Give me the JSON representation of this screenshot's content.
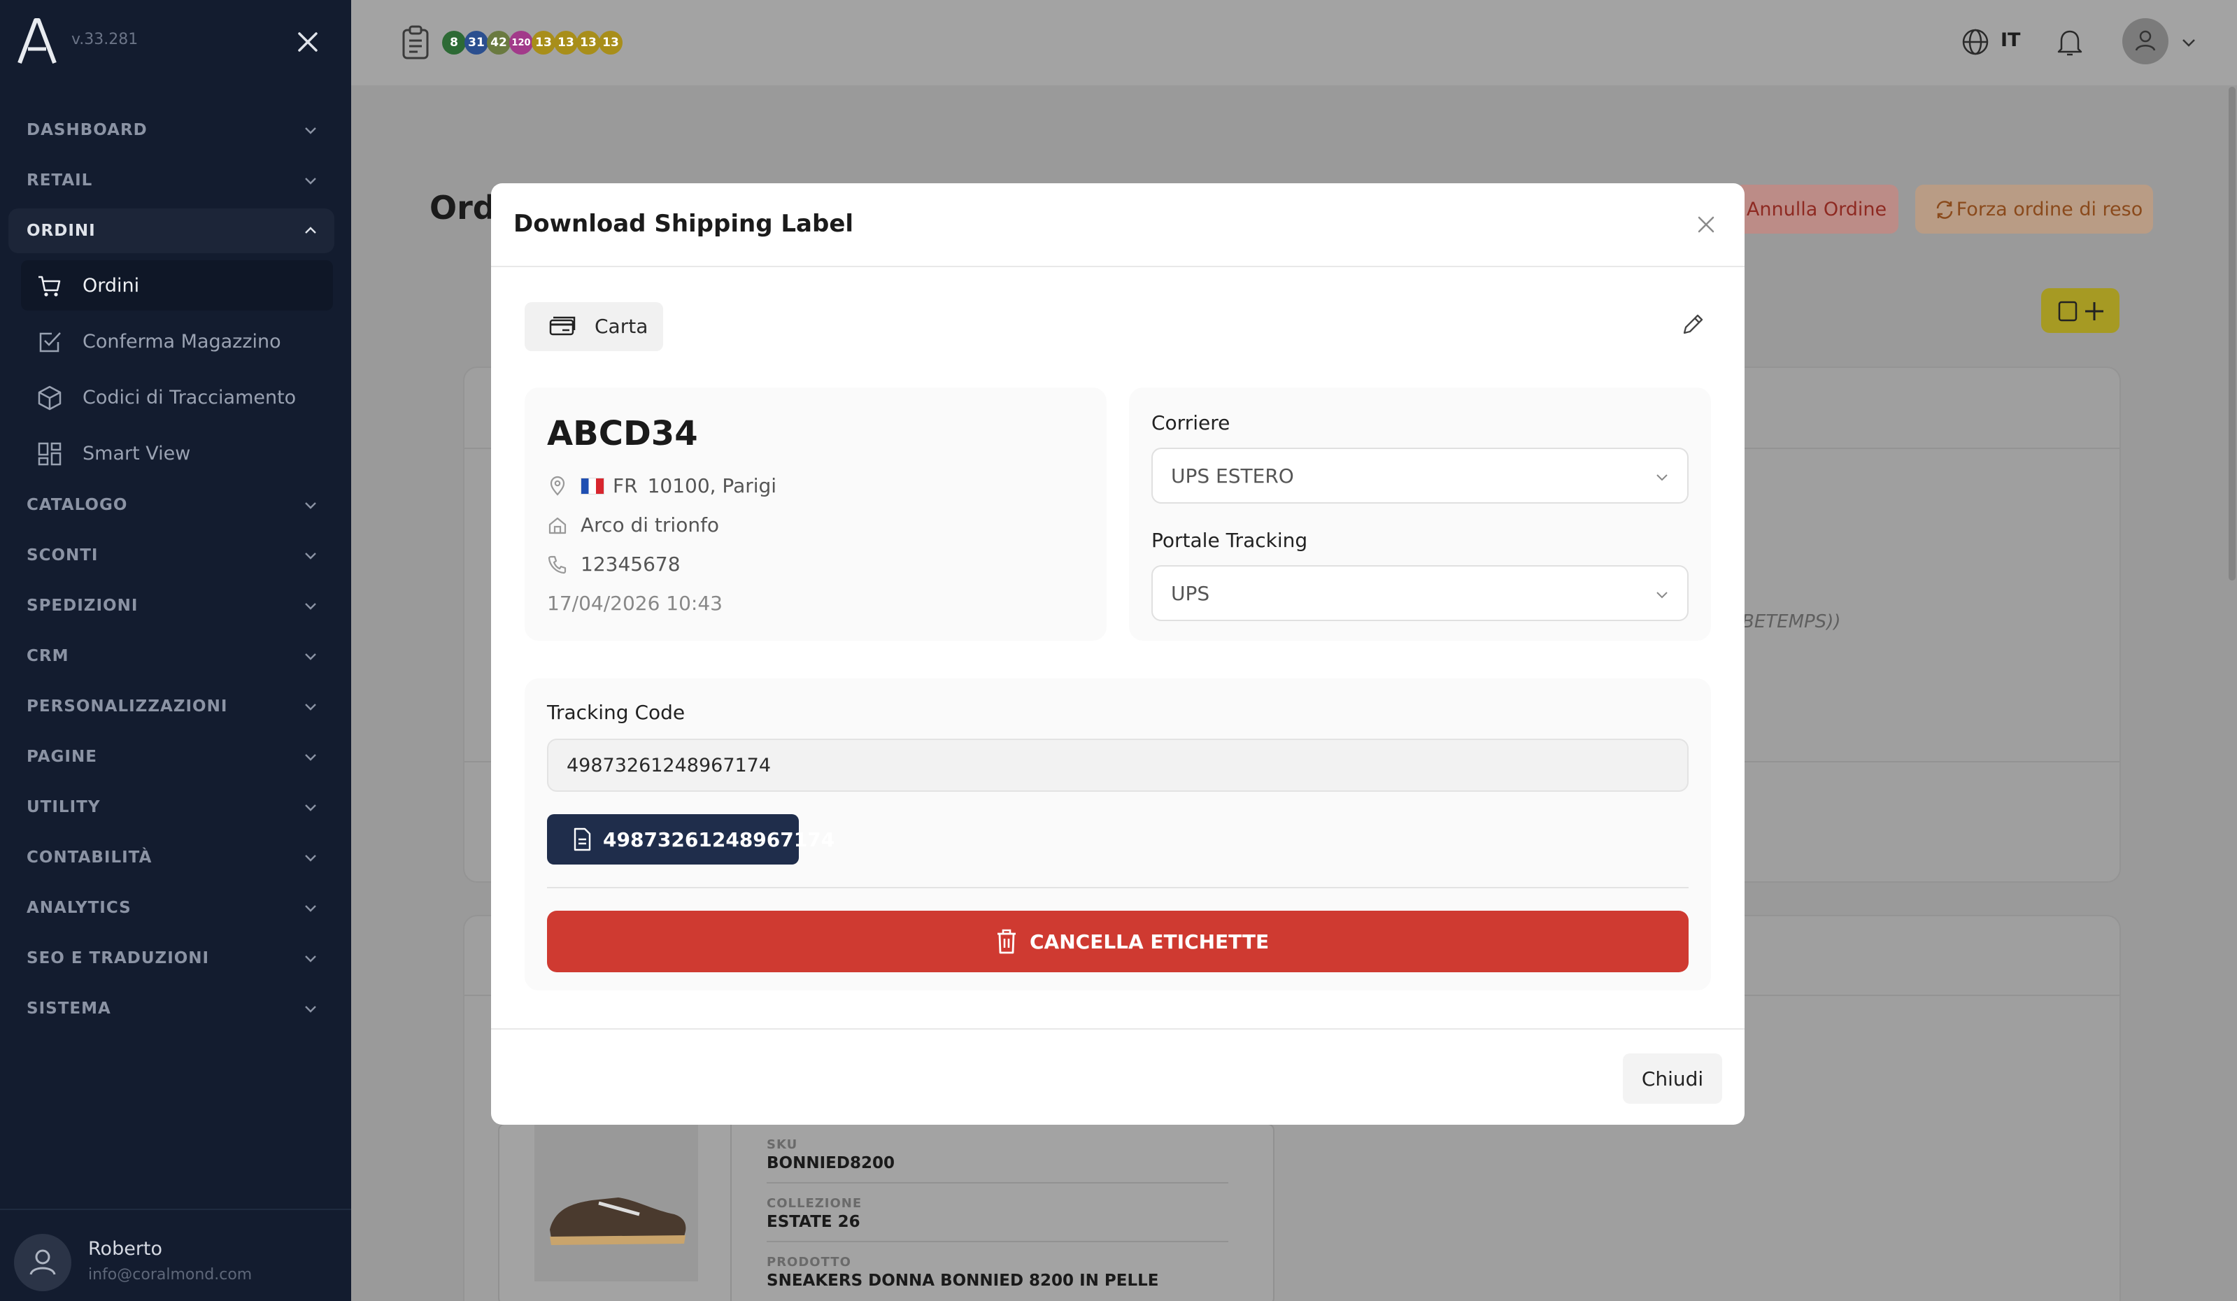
{
  "app": {
    "version": "v.33.281"
  },
  "sidebar": {
    "groups_top": [
      {
        "label": "DASHBOARD"
      },
      {
        "label": "RETAIL"
      },
      {
        "label": "ORDINI"
      }
    ],
    "ordini_items": [
      {
        "label": "Ordini",
        "icon": "cart-icon",
        "active": true
      },
      {
        "label": "Conferma Magazzino",
        "icon": "checkbox-icon"
      },
      {
        "label": "Codici di Tracciamento",
        "icon": "box-icon"
      },
      {
        "label": "Smart View",
        "icon": "grid-icon"
      }
    ],
    "groups_bottom": [
      {
        "label": "CATALOGO"
      },
      {
        "label": "SCONTI"
      },
      {
        "label": "SPEDIZIONI"
      },
      {
        "label": "CRM"
      },
      {
        "label": "PERSONALIZZAZIONI"
      },
      {
        "label": "PAGINE"
      },
      {
        "label": "UTILITY"
      },
      {
        "label": "CONTABILITÀ"
      },
      {
        "label": "ANALYTICS"
      },
      {
        "label": "SEO E TRADUZIONI"
      },
      {
        "label": "SISTEMA"
      }
    ],
    "user": {
      "name": "Roberto",
      "email": "info@coralmond.com"
    }
  },
  "header": {
    "badges": [
      {
        "value": "8",
        "color": "#2d6a35"
      },
      {
        "value": "31",
        "color": "#2b4f8f"
      },
      {
        "value": "42",
        "color": "#6a7a40"
      },
      {
        "value": "120",
        "color": "#a23a8a"
      },
      {
        "value": "13",
        "color": "#a88e1a"
      },
      {
        "value": "13",
        "color": "#a88e1a"
      },
      {
        "value": "13",
        "color": "#a88e1a"
      },
      {
        "value": "13",
        "color": "#a88e1a"
      }
    ],
    "language": "IT"
  },
  "page": {
    "title_partial": "Ord",
    "buttons": {
      "cancel_order": "Annulla Ordine",
      "force_return": "Forza ordine di reso"
    },
    "italic_fragment": "BETEMPS))",
    "product": {
      "sku_label": "SKU",
      "sku": "BONNIED8200",
      "collection_label": "COLLEZIONE",
      "collection": "ESTATE 26",
      "product_label": "PRODOTTO",
      "product": "SNEAKERS DONNA BONNIED 8200 IN PELLE"
    }
  },
  "modal": {
    "title": "Download Shipping Label",
    "payment_chip": "Carta",
    "address": {
      "code": "ABCD34",
      "country": "FR",
      "city": "10100, Parigi",
      "street": "Arco di trionfo",
      "phone": "12345678",
      "date": "17/04/2026 10:43"
    },
    "courier": {
      "label": "Corriere",
      "value": "UPS ESTERO"
    },
    "tracking_portal": {
      "label": "Portale Tracking",
      "value": "UPS"
    },
    "tracking": {
      "label": "Tracking Code",
      "value": "49873261248967174",
      "document_button": "49873261248967174",
      "delete_button": "CANCELLA ETICHETTE"
    },
    "close_button": "Chiudi"
  },
  "colors": {
    "sidebar_bg": "#131c2f",
    "danger": "#cf3a31",
    "primary_dark": "#1f2d4b"
  }
}
